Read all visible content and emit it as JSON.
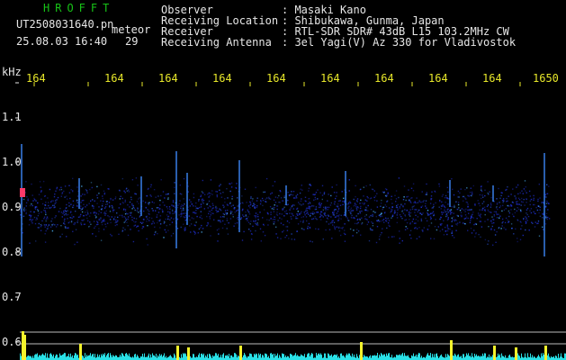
{
  "app": {
    "brand": "HROFFT",
    "filename": "UT2508031640.pn",
    "mode": "meteor",
    "datetime": "25.08.03 16:40",
    "count": "29"
  },
  "header": {
    "rows": [
      {
        "label": "Observer",
        "value": ": Masaki Kano"
      },
      {
        "label": "Receiving Location",
        "value": ": Shibukawa, Gunma, Japan"
      },
      {
        "label": "Receiver",
        "value": ": RTL-SDR SDR# 43dB L15 103.2MHz CW"
      },
      {
        "label": "Receiving Antenna",
        "value": ": 3el Yagi(V) Az 330 for Vladivostok"
      }
    ]
  },
  "axes": {
    "y_unit": "kHz",
    "y_ticks": [
      "1.1",
      "1.0",
      "0.9",
      "0.8",
      "0.7",
      "0.6"
    ],
    "x_ticks": [
      "164",
      "164",
      "164",
      "164",
      "164",
      "164",
      "164",
      "164",
      "164",
      "1650"
    ]
  },
  "colors": {
    "background": "#000000",
    "brand": "#17c317",
    "text": "#e6e6e6",
    "time_labels": "#e7e72a",
    "echo_noise": "#1f2fd0",
    "peak": "#ff3a6a",
    "meter": "#29e0e6"
  }
}
